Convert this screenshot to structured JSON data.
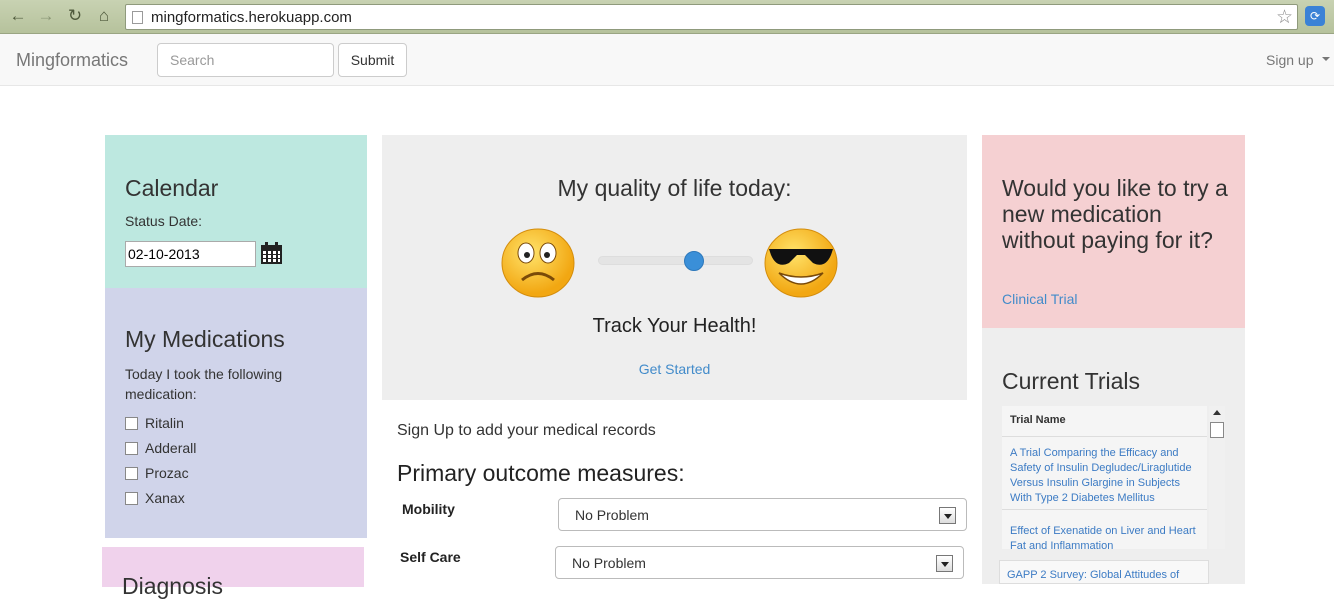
{
  "browser": {
    "url": "mingformatics.herokuapp.com",
    "icons": [
      "back-icon",
      "forward-icon",
      "reload-icon",
      "home-icon",
      "page-icon",
      "star-icon",
      "extension-icon"
    ]
  },
  "navbar": {
    "brand": "Mingformatics",
    "search_placeholder": "Search",
    "submit_label": "Submit",
    "signup_label": "Sign up"
  },
  "calendar": {
    "title": "Calendar",
    "status_label": "Status Date:",
    "date_value": "02-10-2013"
  },
  "medications": {
    "title": "My Medications",
    "description": "Today I took the following medication:",
    "items": [
      "Ritalin",
      "Adderall",
      "Prozac",
      "Xanax"
    ]
  },
  "diagnosis": {
    "title": "Diagnosis"
  },
  "quality": {
    "title": "My quality of life today:",
    "slider_value": 0.62,
    "track_label": "Track Your Health!",
    "get_started": "Get Started"
  },
  "records": {
    "signup_text": "Sign Up to add your medical records",
    "outcome_title": "Primary outcome measures:",
    "measures": [
      {
        "label": "Mobility",
        "value": "No Problem"
      },
      {
        "label": "Self Care",
        "value": "No Problem"
      }
    ]
  },
  "ad": {
    "title": "Would you like to try a new medication without paying for it?",
    "link": "Clinical Trial"
  },
  "trials": {
    "title": "Current Trials",
    "column": "Trial Name",
    "rows": [
      "A Trial Comparing the Efficacy and Safety of Insulin Degludec/Liraglutide Versus Insulin Glargine in Subjects With Type 2 Diabetes Mellitus",
      "Effect of Exenatide on Liver and Heart Fat and Inflammation",
      "GAPP 2 Survey: Global Attitudes of"
    ]
  },
  "colors": {
    "calendar_bg": "#bde8e0",
    "meds_bg": "#d0d4ea",
    "diag_bg": "#f0d2ec",
    "ad_bg": "#f5d0d2",
    "link": "#428bca",
    "slider": "#3a8fd8"
  }
}
